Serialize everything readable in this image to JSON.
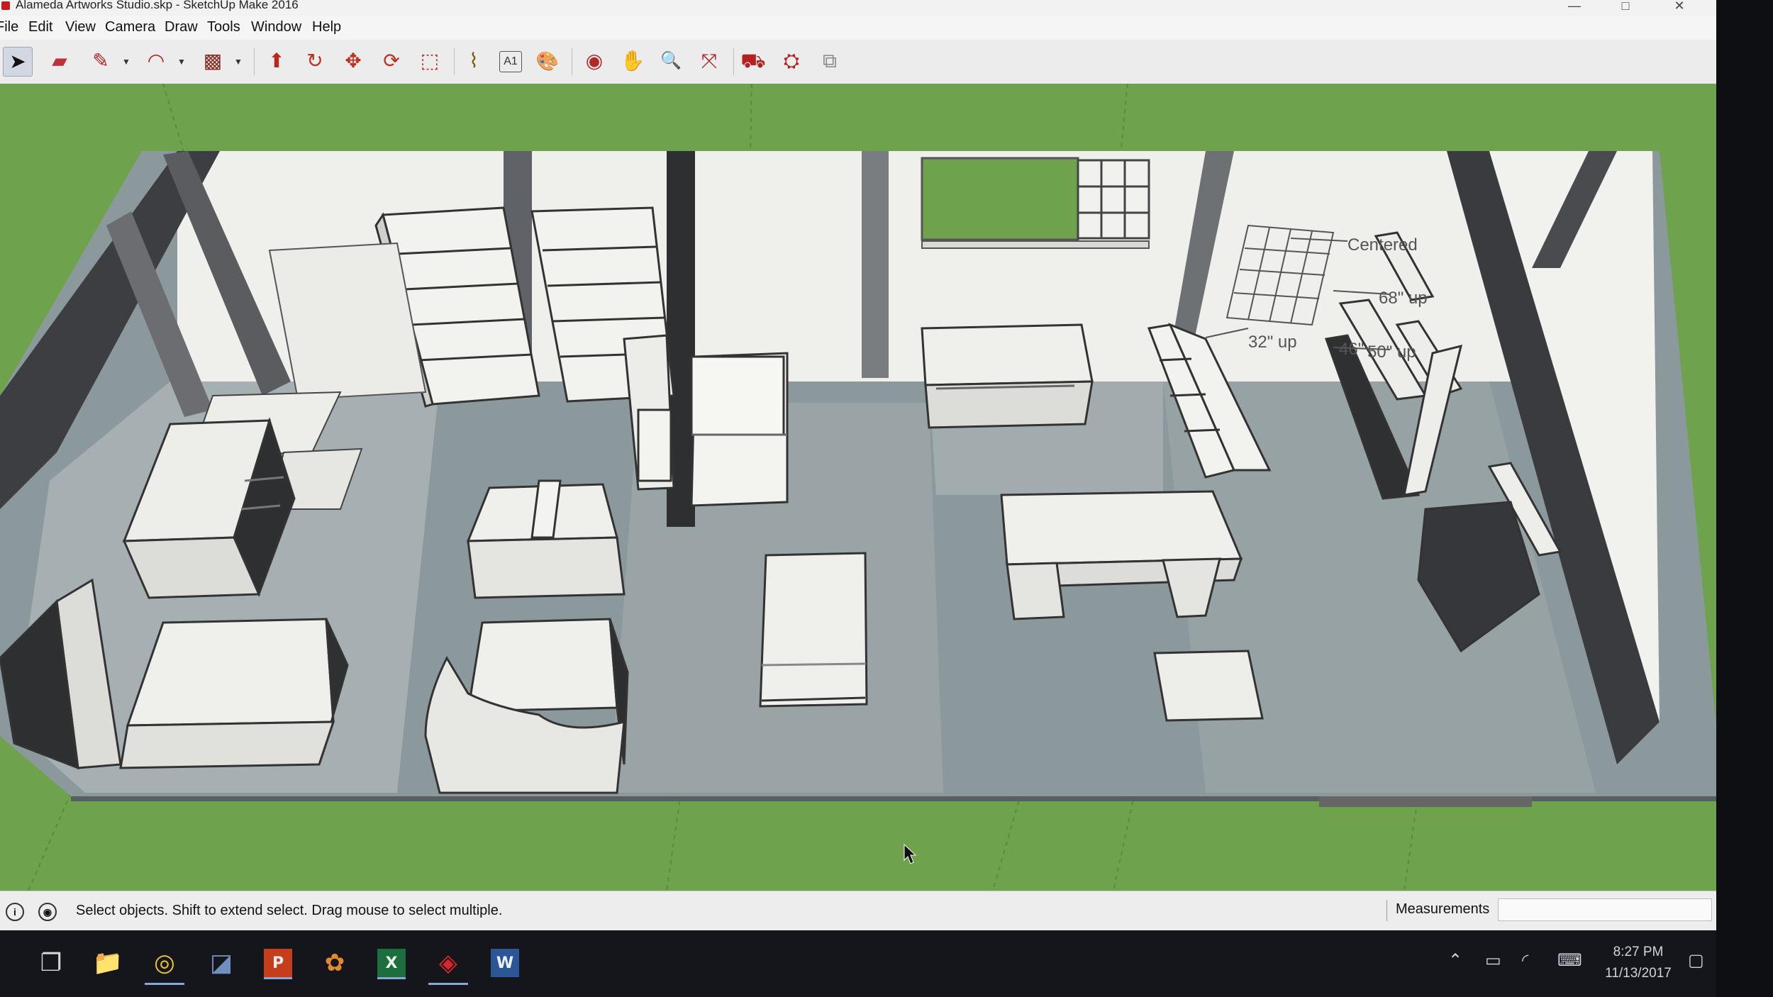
{
  "window": {
    "title": "Alameda Artworks Studio.skp - SketchUp Make 2016",
    "minimize": "—",
    "maximize": "□",
    "close": "✕"
  },
  "menu": [
    "File",
    "Edit",
    "View",
    "Camera",
    "Draw",
    "Tools",
    "Window",
    "Help"
  ],
  "toolbar": {
    "tools": [
      {
        "name": "select-tool",
        "glyph": "➤",
        "active": true
      },
      {
        "name": "eraser-tool",
        "glyph": "▰"
      },
      {
        "name": "line-tool",
        "glyph": "✎"
      },
      {
        "name": "arc-tool",
        "glyph": "◠"
      },
      {
        "name": "rectangle-tool",
        "glyph": "▩"
      },
      {
        "name": "push-pull-tool",
        "glyph": "⬆"
      },
      {
        "name": "offset-tool",
        "glyph": "↻"
      },
      {
        "name": "move-tool",
        "glyph": "✥"
      },
      {
        "name": "rotate-tool",
        "glyph": "⟳"
      },
      {
        "name": "scale-tool",
        "glyph": "⬚"
      },
      {
        "name": "tape-measure-tool",
        "glyph": "⌇"
      },
      {
        "name": "text-tool",
        "glyph": "A1"
      },
      {
        "name": "paint-bucket-tool",
        "glyph": "🎨"
      },
      {
        "name": "orbit-tool",
        "glyph": "◉"
      },
      {
        "name": "pan-tool",
        "glyph": "✋"
      },
      {
        "name": "zoom-tool",
        "glyph": "🔍"
      },
      {
        "name": "zoom-extents-tool",
        "glyph": "⤧"
      },
      {
        "name": "warehouse-tool",
        "glyph": "⛟"
      },
      {
        "name": "extension-warehouse-tool",
        "glyph": "⛭"
      },
      {
        "name": "layout-tool",
        "glyph": "⧉"
      }
    ]
  },
  "model": {
    "labels": [
      "Centered",
      "68\" up",
      "32\" up",
      "46\"",
      "50\" up"
    ]
  },
  "status": {
    "message": "Select objects. Shift to extend select. Drag mouse to select multiple.",
    "measurements_label": "Measurements",
    "measurements_value": ""
  },
  "taskbar": {
    "apps": [
      {
        "name": "task-view-icon",
        "glyph": "❐"
      },
      {
        "name": "file-explorer-icon",
        "glyph": "📁"
      },
      {
        "name": "chrome-icon",
        "glyph": "◎",
        "open": true
      },
      {
        "name": "photo-app-icon",
        "glyph": "◪"
      },
      {
        "name": "powerpoint-icon",
        "glyph": "P",
        "open": true
      },
      {
        "name": "blender-icon",
        "glyph": "✿"
      },
      {
        "name": "excel-icon",
        "glyph": "X",
        "open": true
      },
      {
        "name": "sketchup-icon",
        "glyph": "◈",
        "open": true
      },
      {
        "name": "word-icon",
        "glyph": "W"
      }
    ],
    "time": "8:27 PM",
    "date": "11/13/2017"
  },
  "colors": {
    "ground": "#6fa24d",
    "floor": "#8f9a9d",
    "wall": "#eeeeea",
    "wall_dark": "#3e3f42"
  }
}
